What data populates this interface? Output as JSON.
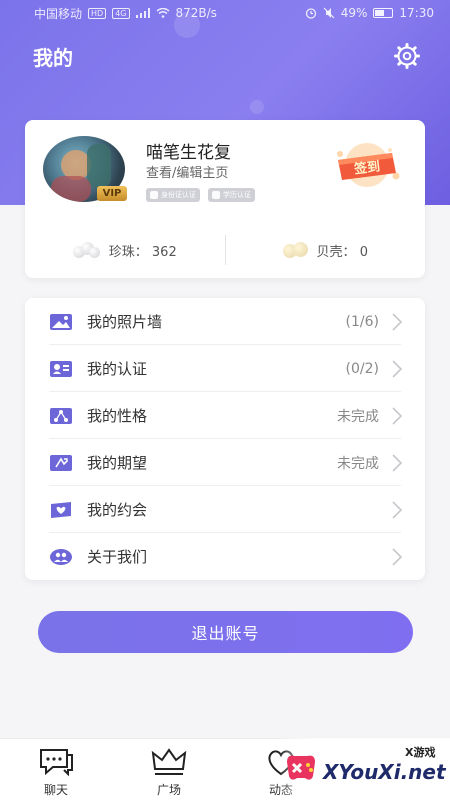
{
  "status_bar": {
    "carrier": "中国移动",
    "hd_badge": "HD",
    "network_badge": "4G",
    "speed": "872B/s",
    "battery": "49%",
    "time": "17:30"
  },
  "header": {
    "title": "我的",
    "settings_icon": "gear-icon"
  },
  "profile": {
    "username": "喵笔生花复",
    "edit_link": "查看/编辑主页",
    "vip_label": "VIP",
    "badges": [
      "身份证认证",
      "学历认证"
    ],
    "checkin_label": "签到",
    "stats": [
      {
        "label": "珍珠：",
        "value": "362"
      },
      {
        "label": "贝壳：",
        "value": "0"
      }
    ]
  },
  "menu": [
    {
      "label": "我的照片墙",
      "value": "(1/6)",
      "icon": "photo-wall-icon"
    },
    {
      "label": "我的认证",
      "value": "(0/2)",
      "icon": "certification-icon"
    },
    {
      "label": "我的性格",
      "value": "未完成",
      "icon": "personality-icon"
    },
    {
      "label": "我的期望",
      "value": "未完成",
      "icon": "expectation-icon"
    },
    {
      "label": "我的约会",
      "value": "",
      "icon": "date-icon"
    },
    {
      "label": "关于我们",
      "value": "",
      "icon": "about-us-icon"
    }
  ],
  "logout_label": "退出账号",
  "tabs": [
    {
      "label": "聊天",
      "icon": "chat-icon"
    },
    {
      "label": "广场",
      "icon": "crown-icon"
    },
    {
      "label": "动态",
      "icon": "heart-icon"
    }
  ],
  "watermark": {
    "small": "X游戏",
    "text": "XYouXi.net"
  },
  "colors": {
    "accent": "#7b73ea",
    "background": "#f5f5f7",
    "card": "#ffffff"
  }
}
